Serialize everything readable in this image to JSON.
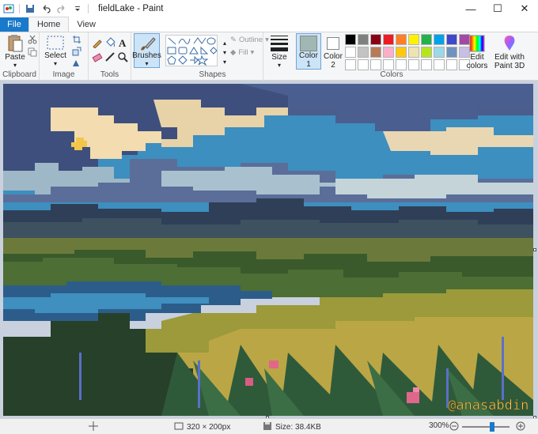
{
  "window": {
    "title": "fieldLake - Paint",
    "minimize": "—",
    "maximize": "☐",
    "close": "✕"
  },
  "tabs": {
    "file": "File",
    "home": "Home",
    "view": "View"
  },
  "ribbon": {
    "clipboard": {
      "label": "Clipboard",
      "paste": "Paste"
    },
    "image": {
      "label": "Image",
      "select": "Select"
    },
    "tools": {
      "label": "Tools"
    },
    "brushes": {
      "label": "Brushes"
    },
    "shapes": {
      "label": "Shapes",
      "outline": "Outline",
      "fill": "Fill"
    },
    "size": {
      "label": "Size"
    },
    "color1": {
      "label": "Color",
      "sub": "1",
      "value": "#9fb8b4"
    },
    "color2": {
      "label": "Color",
      "sub": "2",
      "value": "#ffffff"
    },
    "colors": {
      "label": "Colors",
      "row1": [
        "#000000",
        "#7f7f7f",
        "#880015",
        "#ed1c24",
        "#ff7f27",
        "#fff200",
        "#22b14c",
        "#00a2e8",
        "#3f48cc",
        "#a349a4"
      ],
      "row2": [
        "#ffffff",
        "#c3c3c3",
        "#b97a57",
        "#ffaec9",
        "#ffc90e",
        "#efe4b0",
        "#b5e61d",
        "#99d9ea",
        "#7092be",
        "#c8bfe7"
      ],
      "row3": [
        "#ffffff",
        "#ffffff",
        "#ffffff",
        "#ffffff",
        "#ffffff",
        "#ffffff",
        "#ffffff",
        "#ffffff",
        "#ffffff",
        "#ffffff"
      ]
    },
    "edit_colors": {
      "line1": "Edit",
      "line2": "colors"
    },
    "paint3d": {
      "line1": "Edit with",
      "line2": "Paint 3D"
    }
  },
  "canvas": {
    "watermark": "@anasabdin"
  },
  "status": {
    "dimensions": "320 × 200px",
    "size": "Size: 38.4KB",
    "zoom": "300%"
  }
}
